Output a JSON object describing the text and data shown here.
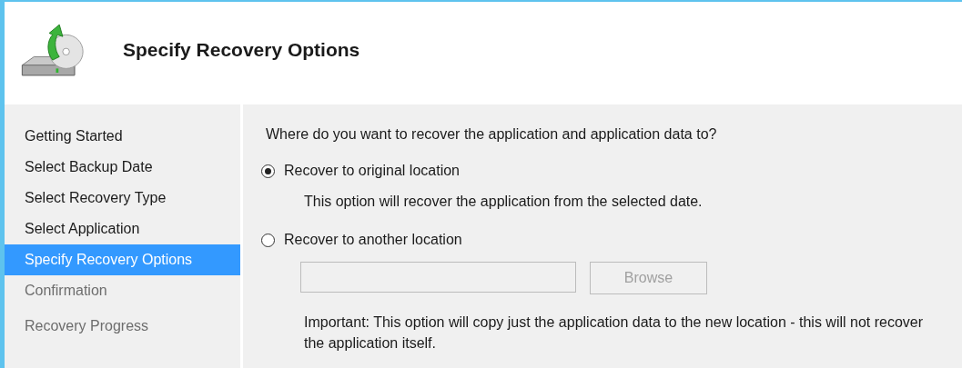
{
  "header": {
    "title": "Specify Recovery Options"
  },
  "steps": [
    {
      "label": "Getting Started",
      "selected": false,
      "disabled": false
    },
    {
      "label": "Select Backup Date",
      "selected": false,
      "disabled": false
    },
    {
      "label": "Select Recovery Type",
      "selected": false,
      "disabled": false
    },
    {
      "label": "Select Application",
      "selected": false,
      "disabled": false
    },
    {
      "label": "Specify Recovery Options",
      "selected": true,
      "disabled": false
    },
    {
      "label": "Confirmation",
      "selected": false,
      "disabled": true
    },
    {
      "label": "Recovery Progress",
      "selected": false,
      "disabled": true
    }
  ],
  "question": "Where do you want to recover the application and application data to?",
  "options": [
    {
      "label": "Recover to original location",
      "selected": true,
      "description": "This option will recover the application from the selected date."
    },
    {
      "label": "Recover to another location",
      "selected": false
    }
  ],
  "location_field": {
    "disabled": true
  },
  "browse_button": {
    "label": "Browse",
    "disabled": true
  },
  "note": "Important: This option will copy just the application data to the new location - this will not recover the application itself."
}
